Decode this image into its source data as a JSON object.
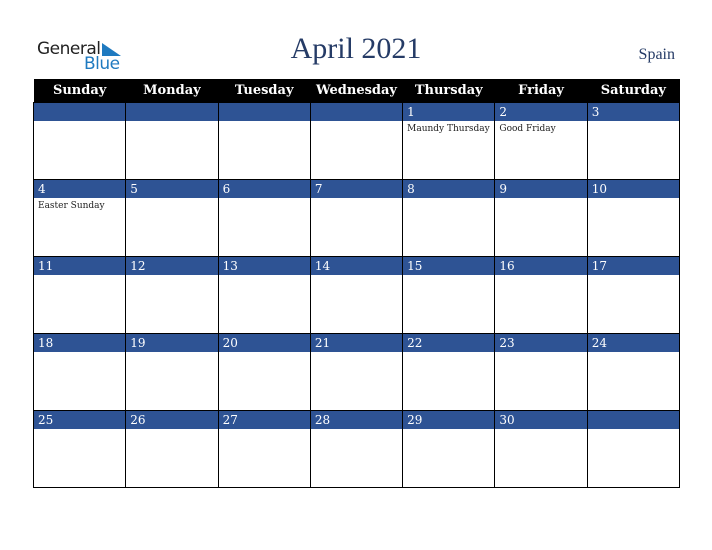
{
  "logo": {
    "general": "General",
    "blue": "Blue"
  },
  "title": "April 2021",
  "country": "Spain",
  "weekdays": [
    "Sunday",
    "Monday",
    "Tuesday",
    "Wednesday",
    "Thursday",
    "Friday",
    "Saturday"
  ],
  "weeks": [
    [
      {
        "day": "",
        "holiday": ""
      },
      {
        "day": "",
        "holiday": ""
      },
      {
        "day": "",
        "holiday": ""
      },
      {
        "day": "",
        "holiday": ""
      },
      {
        "day": "1",
        "holiday": "Maundy Thursday"
      },
      {
        "day": "2",
        "holiday": "Good Friday"
      },
      {
        "day": "3",
        "holiday": ""
      }
    ],
    [
      {
        "day": "4",
        "holiday": "Easter Sunday"
      },
      {
        "day": "5",
        "holiday": ""
      },
      {
        "day": "6",
        "holiday": ""
      },
      {
        "day": "7",
        "holiday": ""
      },
      {
        "day": "8",
        "holiday": ""
      },
      {
        "day": "9",
        "holiday": ""
      },
      {
        "day": "10",
        "holiday": ""
      }
    ],
    [
      {
        "day": "11",
        "holiday": ""
      },
      {
        "day": "12",
        "holiday": ""
      },
      {
        "day": "13",
        "holiday": ""
      },
      {
        "day": "14",
        "holiday": ""
      },
      {
        "day": "15",
        "holiday": ""
      },
      {
        "day": "16",
        "holiday": ""
      },
      {
        "day": "17",
        "holiday": ""
      }
    ],
    [
      {
        "day": "18",
        "holiday": ""
      },
      {
        "day": "19",
        "holiday": ""
      },
      {
        "day": "20",
        "holiday": ""
      },
      {
        "day": "21",
        "holiday": ""
      },
      {
        "day": "22",
        "holiday": ""
      },
      {
        "day": "23",
        "holiday": ""
      },
      {
        "day": "24",
        "holiday": ""
      }
    ],
    [
      {
        "day": "25",
        "holiday": ""
      },
      {
        "day": "26",
        "holiday": ""
      },
      {
        "day": "27",
        "holiday": ""
      },
      {
        "day": "28",
        "holiday": ""
      },
      {
        "day": "29",
        "holiday": ""
      },
      {
        "day": "30",
        "holiday": ""
      },
      {
        "day": "",
        "holiday": ""
      }
    ]
  ],
  "colors": {
    "header_bg": "#000000",
    "day_bar": "#2e5394",
    "title": "#253b66",
    "logo_blue": "#1f7ac0"
  }
}
